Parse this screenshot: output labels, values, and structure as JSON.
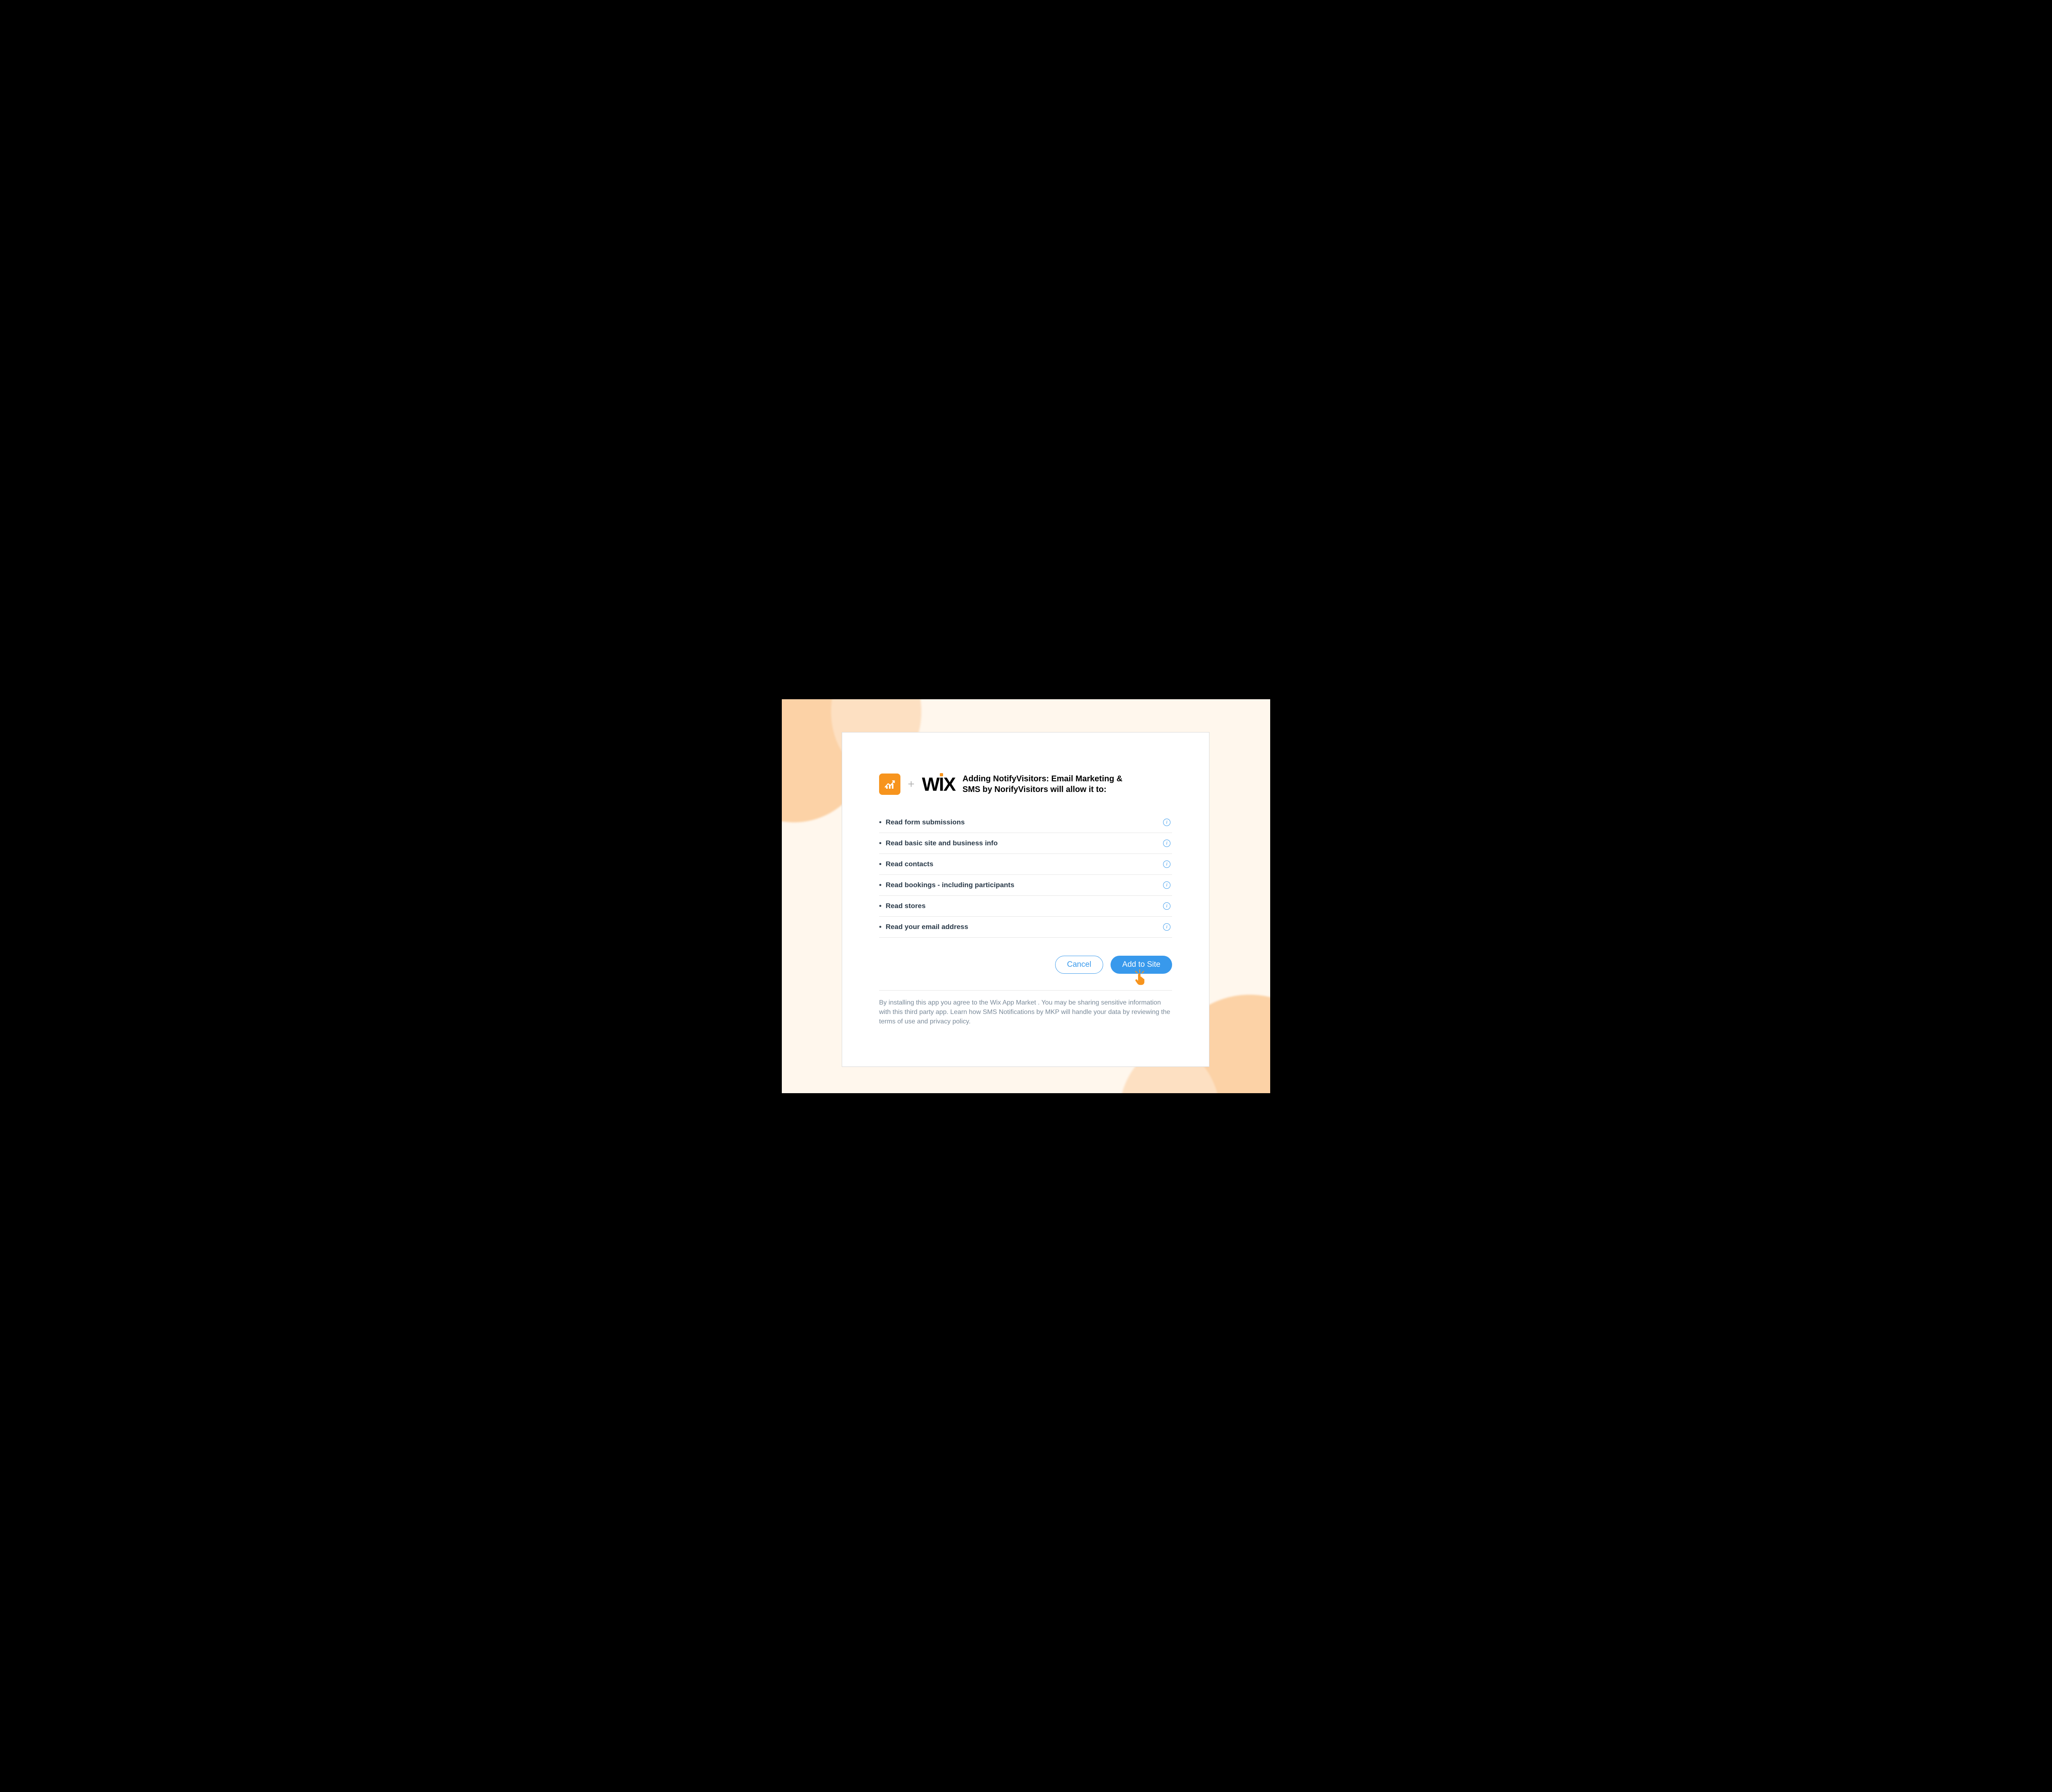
{
  "header": {
    "plus": "+",
    "wix_w": "W",
    "wix_i": "I",
    "wix_x": "X",
    "title": "Adding NotifyVisitors: Email Marketing & SMS by NorifyVisitors will allow it to:"
  },
  "permissions": [
    {
      "label": "Read form submissions"
    },
    {
      "label": "Read basic site and business info"
    },
    {
      "label": "Read contacts"
    },
    {
      "label": "Read bookings - including participants"
    },
    {
      "label": "Read stores"
    },
    {
      "label": "Read your email address"
    }
  ],
  "info_glyph": "i",
  "buttons": {
    "cancel": "Cancel",
    "add": "Add to Site"
  },
  "legal": "By installing this app you agree to the Wix App Market . You may be sharing sensitive information with this third party app. Learn how SMS Notifications by MKP will handle your data by reviewing the terms of use and privacy policy."
}
